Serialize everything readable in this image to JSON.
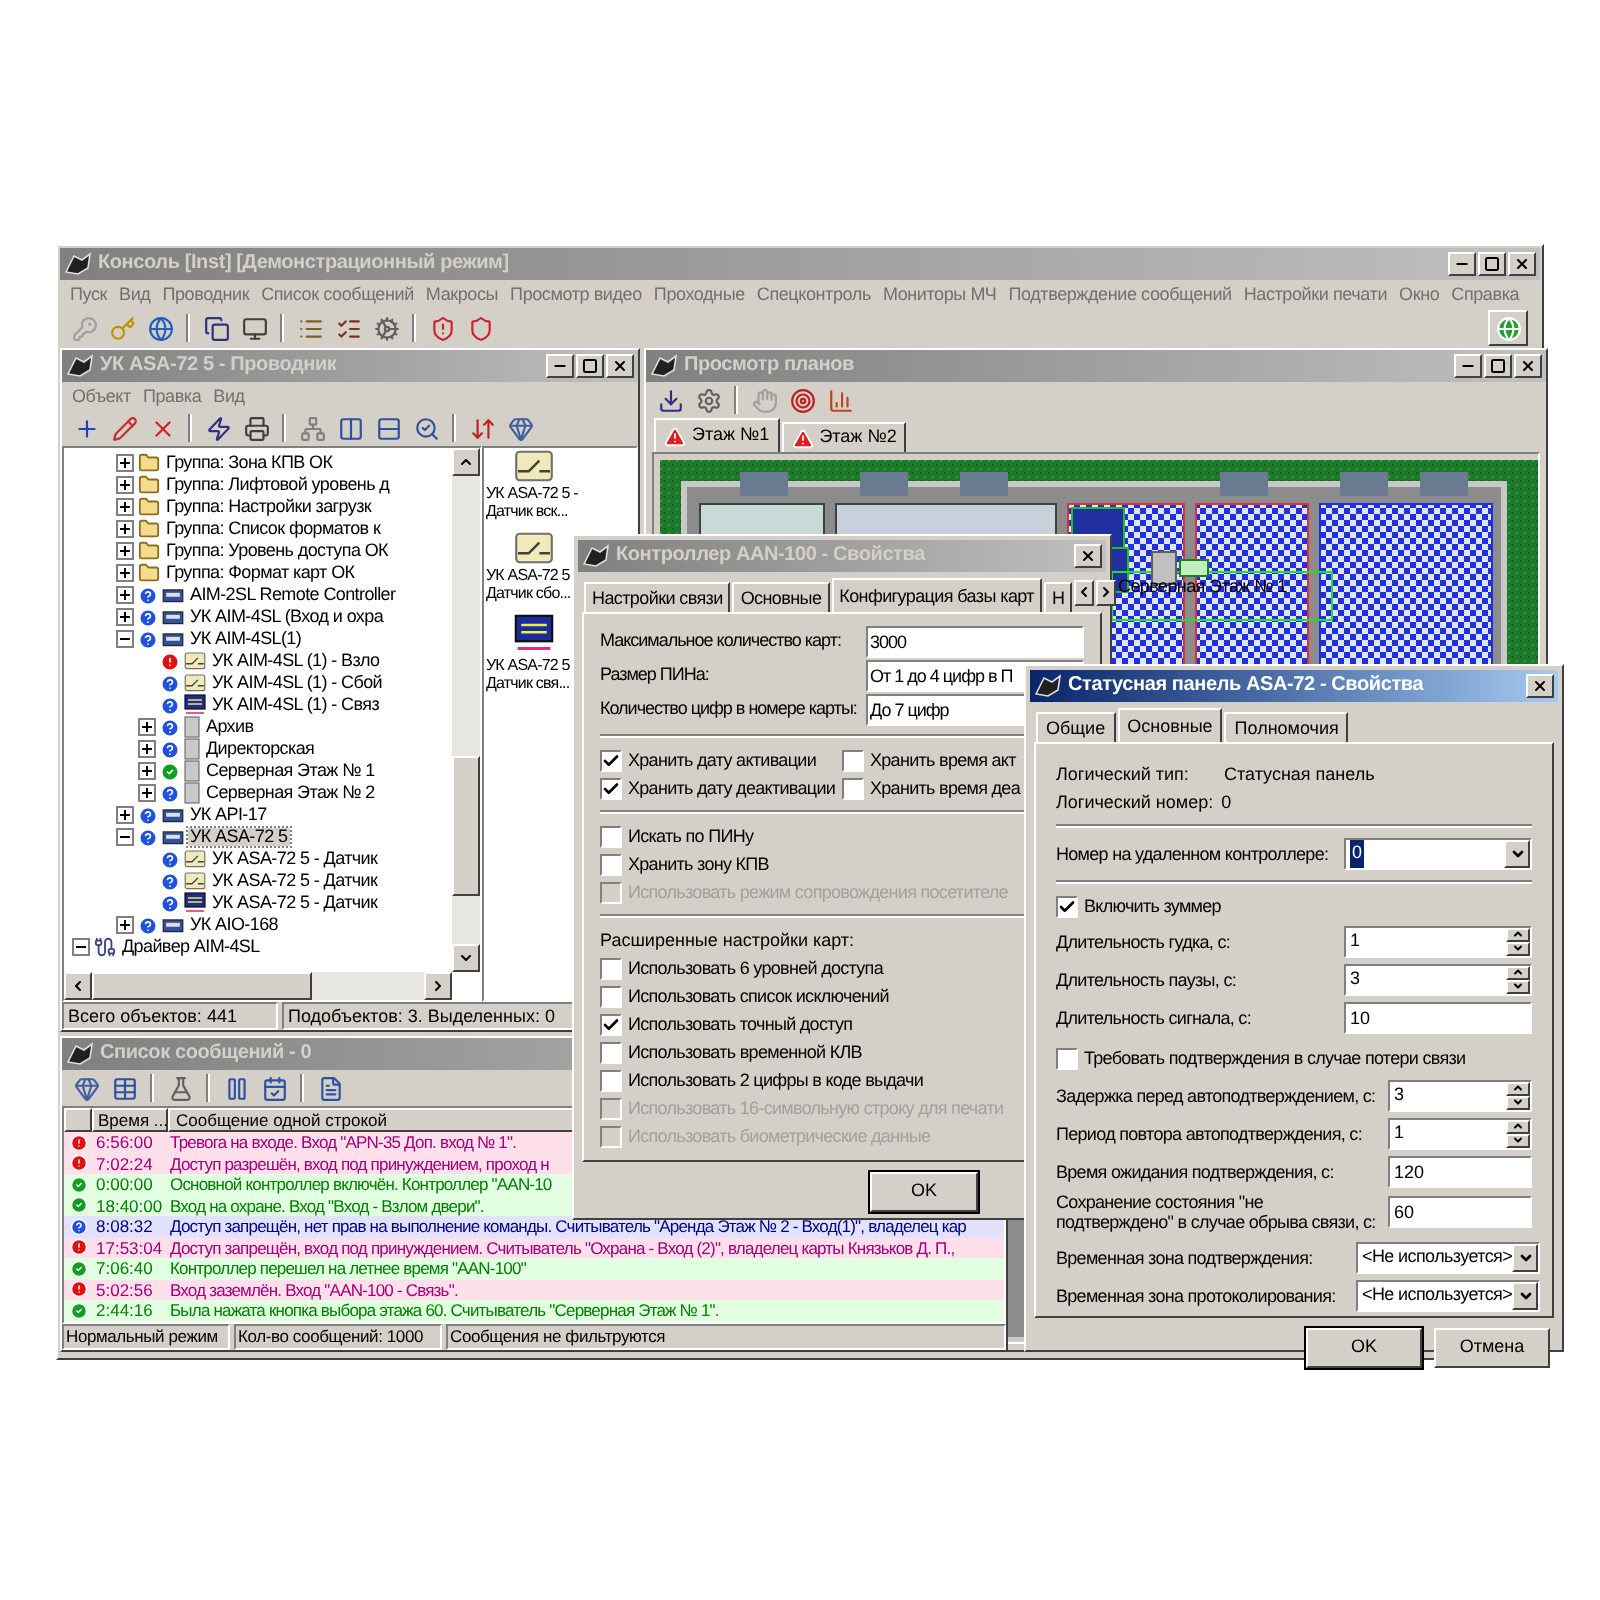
{
  "main_window": {
    "title": "Консоль [Inst] [Демонстрационный режим]",
    "menu": [
      "Пуск",
      "Вид",
      "Проводник",
      "Список сообщений",
      "Макросы",
      "Просмотр видео",
      "Проходные",
      "Спецконтроль",
      "Мониторы МЧ",
      "Подтверждение сообщений",
      "Настройки печати",
      "Окно",
      "Справка"
    ]
  },
  "explorer": {
    "title": "УК ASA-72 5 - Проводник",
    "menu": [
      "Объект",
      "Правка",
      "Вид"
    ],
    "tree": [
      {
        "label": "Группа: Зона КПВ ОК",
        "kind": "group",
        "expanded": false,
        "selected": false
      },
      {
        "label": "Группа: Лифтовой уровень д",
        "kind": "group",
        "expanded": false,
        "selected": false
      },
      {
        "label": "Группа: Настройки загрузк",
        "kind": "group",
        "expanded": false,
        "selected": false
      },
      {
        "label": "Группа: Список форматов к",
        "kind": "group",
        "expanded": false,
        "selected": false
      },
      {
        "label": "Группа: Уровень доступа ОК",
        "kind": "group",
        "expanded": false,
        "selected": false
      },
      {
        "label": "Группа: Формат карт ОК",
        "kind": "group",
        "expanded": false,
        "selected": false
      },
      {
        "label": "AIM-2SL Remote Controller",
        "kind": "controller",
        "alarm": false,
        "normal": false,
        "expanded": false,
        "selected": false
      },
      {
        "label": "УК AIM-4SL (Вход и охра",
        "kind": "controller",
        "alarm": false,
        "normal": false,
        "expanded": false,
        "selected": false
      },
      {
        "label": "УК AIM-4SL(1)",
        "kind": "controller",
        "alarm": false,
        "normal": false,
        "expanded": true,
        "selected": false,
        "children": [
          {
            "label": "УК AIM-4SL (1) - Взло",
            "kind": "sensor",
            "alarm": true,
            "normal": false,
            "selected": false
          },
          {
            "label": "УК AIM-4SL (1) - Сбой",
            "kind": "sensor",
            "alarm": false,
            "normal": false,
            "selected": false
          },
          {
            "label": "УК AIM-4SL (1) - Связ",
            "kind": "link",
            "alarm": false,
            "normal": false,
            "selected": false
          },
          {
            "label": "Архив",
            "kind": "door",
            "alarm": false,
            "normal": false,
            "expanded": false,
            "selected": false
          },
          {
            "label": "Директорская",
            "kind": "door",
            "alarm": false,
            "normal": false,
            "expanded": false,
            "selected": false
          },
          {
            "label": "Серверная Этаж № 1",
            "kind": "door",
            "alarm": false,
            "normal": true,
            "expanded": false,
            "selected": false
          },
          {
            "label": "Серверная Этаж № 2",
            "kind": "door",
            "alarm": false,
            "normal": false,
            "expanded": false,
            "selected": false
          }
        ]
      },
      {
        "label": "УК API-17",
        "kind": "controller",
        "alarm": false,
        "normal": false,
        "expanded": false,
        "selected": false
      },
      {
        "label": "УК ASA-72 5",
        "kind": "controller",
        "alarm": false,
        "normal": false,
        "expanded": true,
        "selected": true,
        "children": [
          {
            "label": "УК ASA-72 5 - Датчик",
            "kind": "sensor",
            "alarm": false,
            "normal": false,
            "selected": false
          },
          {
            "label": "УК ASA-72 5 - Датчик",
            "kind": "sensor",
            "alarm": false,
            "normal": false,
            "selected": false
          },
          {
            "label": "УК ASA-72 5 - Датчик",
            "kind": "link",
            "alarm": false,
            "normal": false,
            "selected": false
          }
        ]
      },
      {
        "label": "УК AIO-168",
        "kind": "controller",
        "alarm": false,
        "normal": false,
        "expanded": false,
        "selected": false
      }
    ],
    "tree_after": [
      {
        "label": "Драйвер AIM-4SL",
        "kind": "driver",
        "expanded": true,
        "selected": false
      }
    ],
    "icons": [
      {
        "label": "УК ASA-72 5 - Датчик вск...",
        "kind": "sensor"
      },
      {
        "label": "УК ASA-72 5 Датчик сбо...",
        "kind": "sensor"
      },
      {
        "label": "УК ASA-72 5 Датчик свя...",
        "kind": "link"
      }
    ],
    "status": [
      "Всего объектов: 441",
      "Подобъектов: 3. Выделенных: 0"
    ]
  },
  "plans": {
    "title": "Просмотр планов",
    "tabs": [
      {
        "label": "Этаж №1",
        "selected": true
      },
      {
        "label": "Этаж №2",
        "selected": false
      }
    ],
    "map_labels": [
      "Серверная Этаж № 1"
    ]
  },
  "messages": {
    "title": "Список сообщений - 0",
    "columns": [
      "Время ...",
      "Сообщение одной строкой"
    ],
    "rows": [
      {
        "kind": "alarm",
        "time": "6:56:00",
        "text": "Тревога на входе. Вход \"APN-35 Доп. вход № 1\"."
      },
      {
        "kind": "alarm",
        "time": "7:02:24",
        "text": "Доступ разрешён, вход под принуждением, проход н"
      },
      {
        "kind": "normal",
        "time": "0:00:00",
        "text": "Основной контроллер включён. Контроллер \"AAN-10"
      },
      {
        "kind": "normal",
        "time": "18:40:00",
        "text": "Вход на охране. Вход \"Вход - Взлом двери\"."
      },
      {
        "kind": "info",
        "time": "8:08:32",
        "text": "Доступ запрещён, нет прав на выполнение команды. Считыватель \"Аренда Этаж № 2 - Вход(1)\", владелец кар"
      },
      {
        "kind": "alarm",
        "time": "17:53:04",
        "text": "Доступ запрещён, вход под принуждением. Считыватель \"Охрана - Вход (2)\", владелец карты Князьков Д. П.,"
      },
      {
        "kind": "normal",
        "time": "7:06:40",
        "text": "Контроллер перешел на летнее время \"AAN-100\""
      },
      {
        "kind": "alarm",
        "time": "5:02:56",
        "text": "Вход заземлён. Вход \"AAN-100 - Связь\"."
      },
      {
        "kind": "normal",
        "time": "2:44:16",
        "text": "Была нажата кнопка выбора этажа 60. Считыватель \"Серверная Этаж № 1\"."
      }
    ],
    "status": [
      "Нормальный режим",
      "Кол-во сообщений: 1000",
      "Сообщения не фильтруются"
    ]
  },
  "controller_dialog": {
    "title": "Контроллер AAN-100 - Свойства",
    "tabs": [
      {
        "label": "Настройки связи",
        "selected": false
      },
      {
        "label": "Основные",
        "selected": false
      },
      {
        "label": "Конфигурация базы карт",
        "selected": true
      },
      {
        "label": "Н",
        "selected": false
      }
    ],
    "fields": [
      {
        "label": "Максимальное количество карт:",
        "value": "3000"
      },
      {
        "label": "Размер ПИНа:",
        "value": "От 1 до 4 цифр в П"
      },
      {
        "label": "Количество цифр в номере карты:",
        "value": "До 7 цифр"
      }
    ],
    "store_options": [
      {
        "label": "Хранить дату активации",
        "checked": true
      },
      {
        "label": "Хранить время акт",
        "checked": false
      },
      {
        "label": "Хранить дату деактивации",
        "checked": true
      },
      {
        "label": "Хранить время деа",
        "checked": false
      }
    ],
    "options": [
      {
        "label": "Искать по ПИНу",
        "checked": false,
        "disabled": false
      },
      {
        "label": "Хранить зону КПВ",
        "checked": false,
        "disabled": false
      },
      {
        "label": "Использовать режим сопровождения посетителе",
        "checked": false,
        "disabled": true
      }
    ],
    "extended_heading": "Расширенные настройки карт:",
    "extended_options": [
      {
        "label": "Использовать 6 уровней доступа",
        "checked": false,
        "disabled": false
      },
      {
        "label": "Использовать список исключений",
        "checked": false,
        "disabled": false
      },
      {
        "label": "Использовать точный доступ",
        "checked": true,
        "disabled": false
      },
      {
        "label": "Использовать временной КЛВ",
        "checked": false,
        "disabled": false
      },
      {
        "label": "Использовать 2 цифры в коде выдачи",
        "checked": false,
        "disabled": false
      },
      {
        "label": "Использовать 16-символьную строку для печати",
        "checked": false,
        "disabled": true
      },
      {
        "label": "Использовать биометрические данные",
        "checked": false,
        "disabled": true
      }
    ],
    "buttons": [
      "OK"
    ]
  },
  "status_dialog": {
    "title": "Статусная панель ASA-72 - Свойства",
    "tabs": [
      {
        "label": "Общие",
        "selected": false
      },
      {
        "label": "Основные",
        "selected": true
      },
      {
        "label": "Полномочия",
        "selected": false
      }
    ],
    "info": [
      {
        "label": "Логический тип:",
        "value": "Статусная панель"
      },
      {
        "label": "Логический номер:",
        "value": "0"
      }
    ],
    "remote": {
      "label": "Номер на удаленном контроллере:",
      "value": "0"
    },
    "buzzer": {
      "label": "Включить зуммер",
      "checked": true
    },
    "buzzer_rows": [
      {
        "kind": "spin",
        "label": "Длительность гудка, с:",
        "value": "1"
      },
      {
        "kind": "spin",
        "label": "Длительность паузы, с:",
        "value": "3"
      },
      {
        "kind": "text",
        "label": "Длительность сигнала, с:",
        "value": "10"
      }
    ],
    "confirm": {
      "label": "Требовать подтверждения в случае потери связи",
      "checked": false
    },
    "confirm_rows": [
      {
        "kind": "spin",
        "label": "Задержка перед автоподтверждением, с:",
        "value": "3"
      },
      {
        "kind": "spin",
        "label": "Период повтора автоподтверждения, с:",
        "value": "1"
      },
      {
        "kind": "text",
        "label": "Время ожидания подтверждения, с:",
        "value": "120"
      },
      {
        "kind": "text",
        "label": "Сохранение состояния \"не подтверждено\" в случае обрыва связи, с:",
        "value": "60"
      }
    ],
    "zone_rows": [
      {
        "kind": "select",
        "label": "Временная зона подтверждения:",
        "value": "<Не используется>"
      },
      {
        "kind": "select",
        "label": "Временная зона протоколирования:",
        "value": "<Не используется>"
      }
    ],
    "buttons": [
      "OK",
      "Отмена"
    ]
  }
}
